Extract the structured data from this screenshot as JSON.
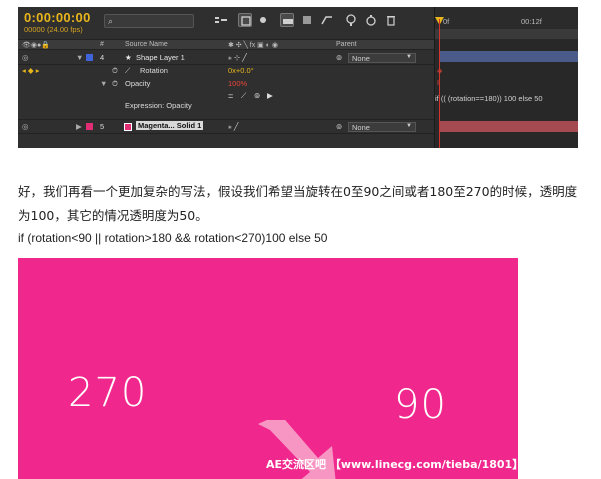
{
  "ae": {
    "timecode": "0:00:00:00",
    "fps_info": "00000 (24.00 fps)",
    "headers": {
      "source_name": "Source Name",
      "parent": "Parent"
    },
    "layers": [
      {
        "index": "4",
        "name": "Shape Layer 1",
        "parent": "None",
        "label_color": "#3f63d8"
      },
      {
        "index": "5",
        "name": "Magenta... Solid 1",
        "parent": "None",
        "label_color": "#e02d74"
      }
    ],
    "props": {
      "rotation_label": "Rotation",
      "rotation_value": "0x+0.0°",
      "opacity_label": "Opacity",
      "opacity_value": "100%",
      "expression_label": "Expression: Opacity"
    },
    "ruler": {
      "t0": "0f",
      "t12": "00:12f"
    },
    "expression_text": "if (( (rotation==180)) 100 else 50"
  },
  "article": {
    "paragraph": "好，我们再看一个更加复杂的写法，假设我们希望当旋转在0至90之间或者180至270的时候，透明度为100，其它的情况透明度为50。",
    "code": "if (rotation<90 || rotation>180 && rotation<270)100 else 50"
  },
  "demo": {
    "label_left": "270",
    "label_right": "90",
    "watermark": "AE交流区吧 【www.linecg.com/tieba/1801】",
    "bg_color": "#f0278d"
  }
}
